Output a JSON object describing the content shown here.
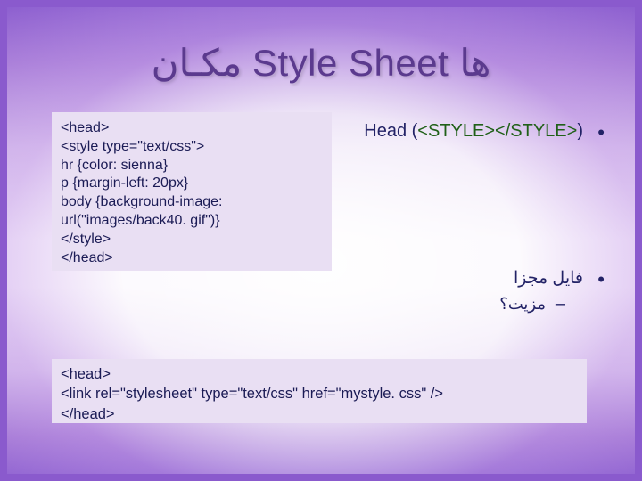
{
  "title": "مکـان Style Sheet ها",
  "code1": {
    "l1": "<head>",
    "l2": "<style type=\"text/css\">",
    "l3": "hr {color: sienna}",
    "l4": "p {margin-left: 20px}",
    "l5": "body {background-image:",
    "l6": "url(\"images/back40. gif\")}",
    "l7": "</style>",
    "l8": "</head>"
  },
  "bullet1": {
    "open": "(",
    "tagopen": "<STYLE>",
    "tagclose": "</STYLE>",
    "close": ")",
    "word": " Head"
  },
  "bullet2": "فایل مجزا",
  "sub": "مزیت؟",
  "code2": {
    "l1": "<head>",
    "l2": "<link rel=\"stylesheet\" type=\"text/css\" href=\"mystyle. css\" />",
    "l3": "</head>"
  }
}
